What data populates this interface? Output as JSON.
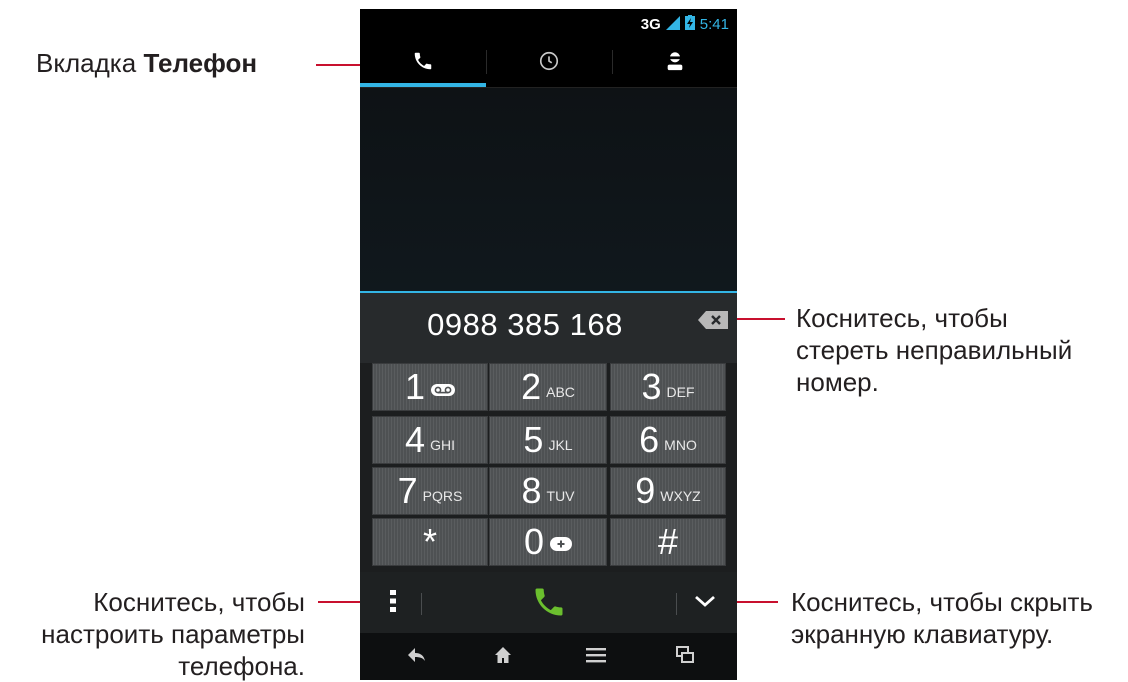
{
  "annotations": {
    "phone_tab_prefix": "Вкладка",
    "phone_tab_bold": "Телефон",
    "backspace_line1": "Коснитесь, чтобы",
    "backspace_line2": "стереть неправильный",
    "backspace_line3": "номер.",
    "menu_line1": "Коснитесь, чтобы",
    "menu_line2": "настроить параметры",
    "menu_line3": "телефона.",
    "hide_line1": "Коснитесь, чтобы скрыть",
    "hide_line2": "экранную клавиатуру."
  },
  "colors": {
    "accent": "#33b5e5",
    "call_green": "#6bbf2e",
    "annotation_line": "#c8102e"
  },
  "status_bar": {
    "network": "3G",
    "time": "5:41",
    "icons": [
      "signal-icon",
      "battery-charging-icon"
    ]
  },
  "tabs": [
    {
      "name": "phone",
      "icon": "phone-icon",
      "active": true
    },
    {
      "name": "recent",
      "icon": "clock-icon",
      "active": false
    },
    {
      "name": "contacts",
      "icon": "person-icon",
      "active": false
    }
  ],
  "dialer": {
    "number": "0988 385 168",
    "keys": [
      {
        "digit": "1",
        "letters": ""
      },
      {
        "digit": "2",
        "letters": "ABC"
      },
      {
        "digit": "3",
        "letters": "DEF"
      },
      {
        "digit": "4",
        "letters": "GHI"
      },
      {
        "digit": "5",
        "letters": "JKL"
      },
      {
        "digit": "6",
        "letters": "MNO"
      },
      {
        "digit": "7",
        "letters": "PQRS"
      },
      {
        "digit": "8",
        "letters": "TUV"
      },
      {
        "digit": "9",
        "letters": "WXYZ"
      },
      {
        "digit": "*",
        "letters": ""
      },
      {
        "digit": "0",
        "letters": ""
      },
      {
        "digit": "#",
        "letters": ""
      }
    ]
  },
  "nav_icons": [
    "back-icon",
    "home-icon",
    "menu-icon",
    "recent-apps-icon"
  ]
}
